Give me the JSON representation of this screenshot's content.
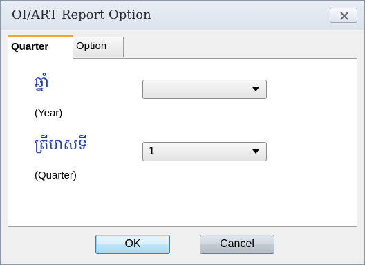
{
  "window": {
    "title": "OI/ART Report Option",
    "close_icon": "close-icon"
  },
  "tabs": [
    {
      "label": "Quarter",
      "selected": true
    },
    {
      "label": "Option",
      "selected": false
    }
  ],
  "form": {
    "year": {
      "label_khmer": "ឆ្នាំ",
      "label_english": "(Year)",
      "value": ""
    },
    "quarter": {
      "label_khmer": "ត្រីមាសទី",
      "label_english": "(Quarter)",
      "value": "1"
    }
  },
  "buttons": {
    "ok_label": "OK",
    "cancel_label": "Cancel"
  },
  "colors": {
    "khmer_label": "#1f3fb0",
    "selected_tab_accent": "#f2a33a"
  }
}
